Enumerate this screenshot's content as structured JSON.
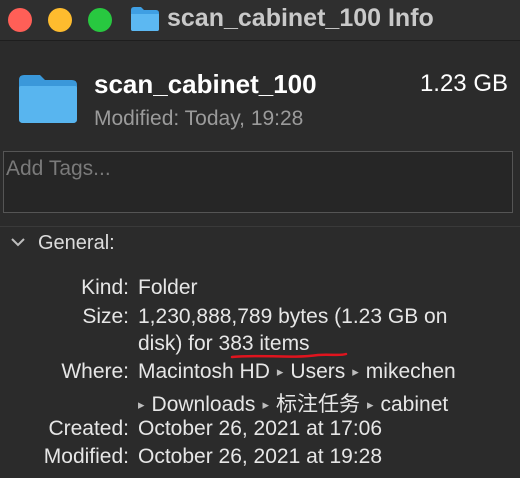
{
  "window": {
    "title": "scan_cabinet_100 Info",
    "colors": {
      "close": "#ff5f57",
      "minimize": "#febc2e",
      "zoom": "#28c840",
      "folder": "#4aa9e9",
      "annotation": "#e0141e"
    }
  },
  "header": {
    "name": "scan_cabinet_100",
    "size": "1.23 GB",
    "modified": "Modified: Today, 19:28",
    "icon": "folder-icon"
  },
  "tags": {
    "placeholder": "Add Tags..."
  },
  "general": {
    "title": "General:",
    "kind": {
      "label": "Kind:",
      "value": "Folder"
    },
    "size": {
      "label": "Size:",
      "line1": "1,230,888,789 bytes (1.23 GB on",
      "line2_prefix": "disk) for ",
      "line2_items": "383 items"
    },
    "where": {
      "label": "Where:",
      "path": [
        "Macintosh HD",
        "Users",
        "mikechen",
        "Downloads",
        "标注任务",
        "cabinet"
      ]
    },
    "created": {
      "label": "Created:",
      "value": "October 26, 2021 at 17:06"
    },
    "modified": {
      "label": "Modified:",
      "value": "October 26, 2021 at 19:28"
    }
  }
}
